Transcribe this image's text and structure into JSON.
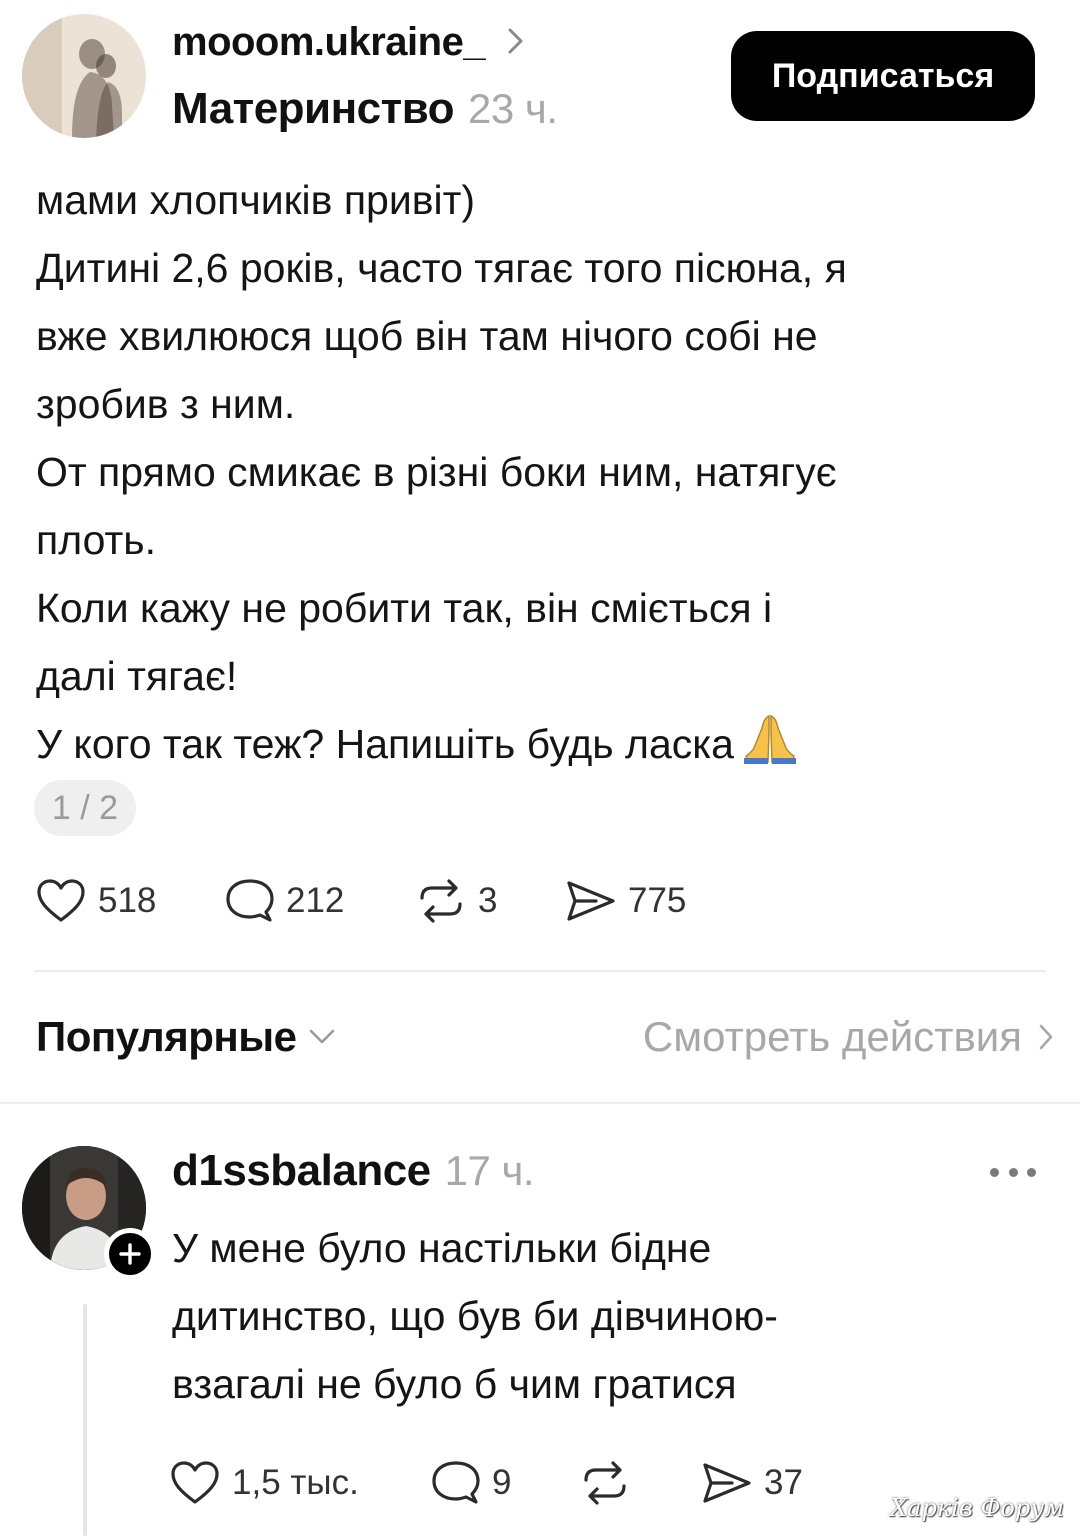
{
  "post": {
    "author": "mooom.ukraine_",
    "community": "Материнство",
    "time": "23 ч.",
    "follow_label": "Подписаться",
    "lines": [
      "мами хлопчиків привіт)",
      "Дитині 2,6 років, часто тягає того пісюна, я",
      "вже хвилююся щоб він там нічого собі не",
      "зробив з ним.",
      "От прямо смикає в різні боки ним, натягує",
      "плоть.",
      "Коли кажу не робити так, він сміється і",
      "далі тягає!",
      "У кого так теж? Напишіть будь ласка"
    ],
    "emoji": "folded-hands-emoji",
    "pager": "1 / 2",
    "stats": {
      "likes": "518",
      "comments": "212",
      "reposts": "3",
      "shares": "775"
    }
  },
  "sort": {
    "label": "Популярные",
    "activity_link": "Смотреть действия"
  },
  "reply": {
    "author": "d1ssbalance",
    "time": "17 ч.",
    "lines": [
      "У мене було настільки бідне",
      "дитинство, що був би дівчиною-",
      "взагалі не було б чим гратися"
    ],
    "stats": {
      "likes": "1,5 тыс.",
      "comments": "9",
      "reposts": "",
      "shares": "37"
    }
  },
  "watermark": "Харків Форум",
  "icons": [
    "chevron-right-icon",
    "heart-icon",
    "comment-icon",
    "repost-icon",
    "share-icon",
    "chevron-down-icon",
    "more-icon",
    "plus-icon"
  ],
  "colors": {
    "text": "#111111",
    "muted": "#a8a8a8",
    "button_bg": "#000000",
    "button_text": "#ffffff",
    "divider": "#ececec"
  }
}
